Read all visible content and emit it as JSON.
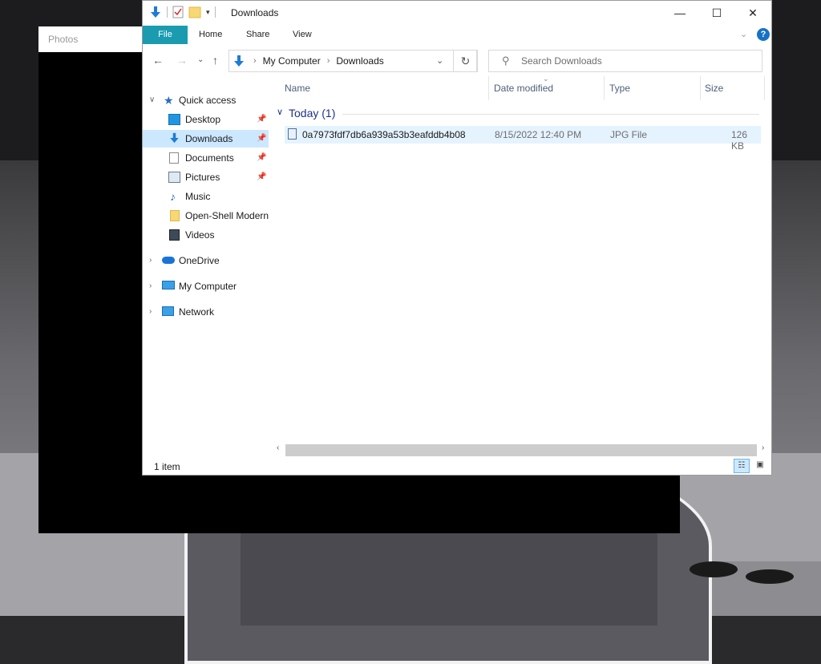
{
  "photos": {
    "title": "Photos"
  },
  "explorer": {
    "title": "Downloads",
    "ribbon": {
      "file": "File",
      "home": "Home",
      "share": "Share",
      "view": "View"
    },
    "address": {
      "crumbs": [
        "My Computer",
        "Downloads"
      ]
    },
    "search": {
      "placeholder": "Search Downloads"
    },
    "nav": {
      "quick_access": "Quick access",
      "items": [
        "Desktop",
        "Downloads",
        "Documents",
        "Pictures",
        "Music",
        "Open-Shell Modern",
        "Videos"
      ],
      "onedrive": "OneDrive",
      "my_computer": "My Computer",
      "network": "Network"
    },
    "columns": {
      "name": "Name",
      "date": "Date modified",
      "type": "Type",
      "size": "Size"
    },
    "group": "Today (1)",
    "files": [
      {
        "name": "0a7973fdf7db6a939a53b3eafddb4b08",
        "date": "8/15/2022 12:40 PM",
        "type": "JPG File",
        "size": "126 KB"
      }
    ],
    "status": "1 item"
  },
  "colors": {
    "accent": "#1a9bb0",
    "selection": "#cce8ff",
    "row_selection": "#e5f3ff",
    "group_text": "#1e3287"
  }
}
